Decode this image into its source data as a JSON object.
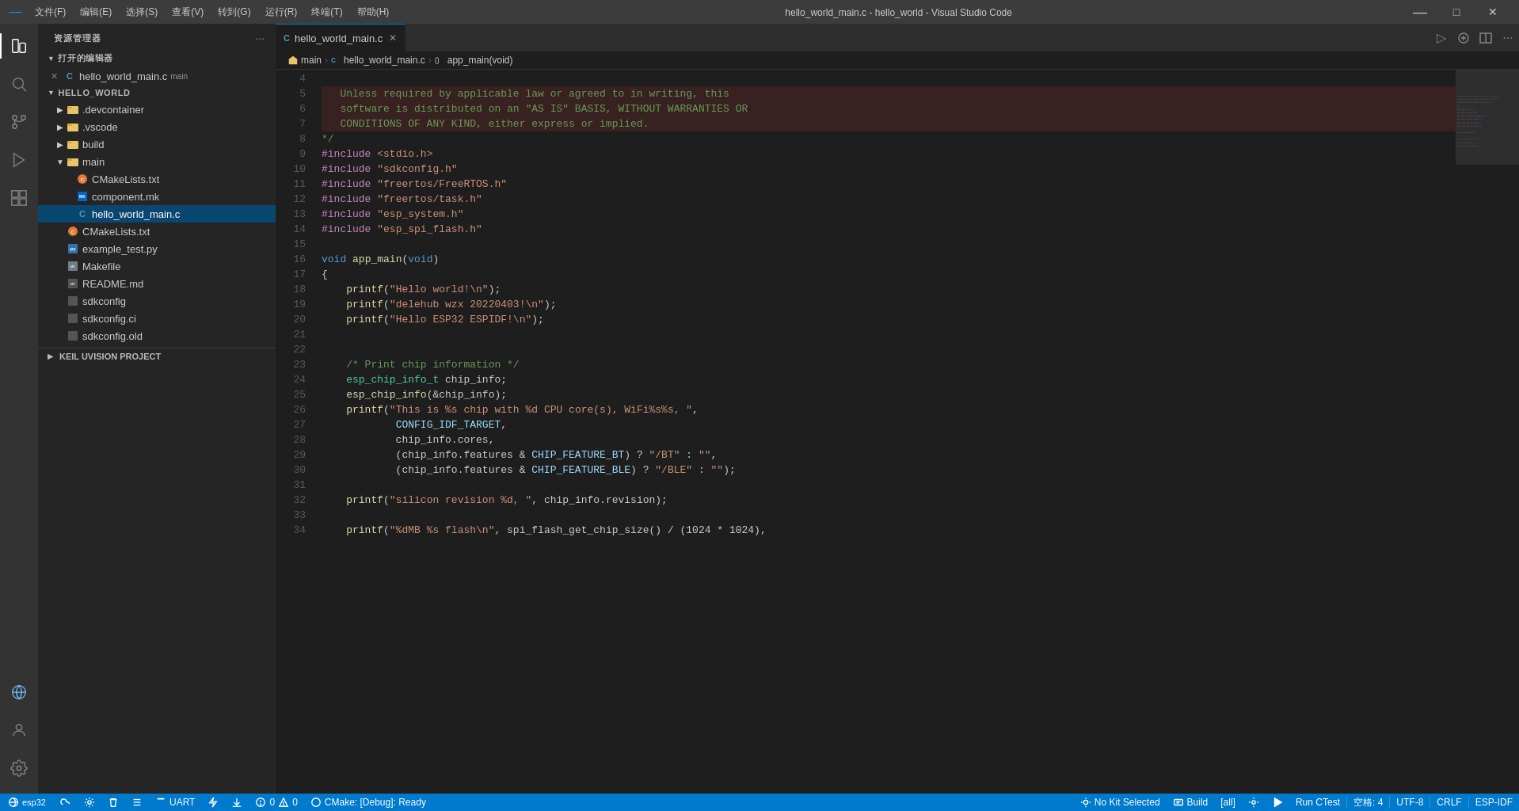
{
  "titlebar": {
    "icon": "⊘",
    "menu": [
      "文件(F)",
      "编辑(E)",
      "选择(S)",
      "查看(V)",
      "转到(G)",
      "运行(R)",
      "终端(T)",
      "帮助(H)"
    ],
    "title": "hello_world_main.c - hello_world - Visual Studio Code",
    "controls": {
      "minimize": "─",
      "maximize": "□",
      "close": "✕"
    }
  },
  "activity_bar": {
    "items": [
      {
        "name": "explorer",
        "icon": "⧉",
        "active": true
      },
      {
        "name": "search",
        "icon": "🔍"
      },
      {
        "name": "source-control",
        "icon": "⑂"
      },
      {
        "name": "run-debug",
        "icon": "▷"
      },
      {
        "name": "extensions",
        "icon": "⊞"
      }
    ],
    "bottom": [
      {
        "name": "remote",
        "icon": "⊡"
      },
      {
        "name": "account",
        "icon": "👤"
      },
      {
        "name": "settings",
        "icon": "⚙"
      }
    ]
  },
  "sidebar": {
    "title": "资源管理器",
    "actions": [
      "...",
      ""
    ],
    "open_editors": {
      "label": "打开的编辑器",
      "files": [
        {
          "name": "hello_world_main.c",
          "badge": "main",
          "modified": true
        }
      ]
    },
    "project": {
      "name": "HELLO_WORLD",
      "items": [
        {
          "type": "folder",
          "name": ".devcontainer",
          "indent": 1,
          "expanded": false
        },
        {
          "type": "folder",
          "name": ".vscode",
          "indent": 1,
          "expanded": false
        },
        {
          "type": "folder",
          "name": "build",
          "indent": 1,
          "expanded": false
        },
        {
          "type": "folder",
          "name": "main",
          "indent": 1,
          "expanded": true
        },
        {
          "type": "cmake",
          "name": "CMakeLists.txt",
          "indent": 2
        },
        {
          "type": "mk",
          "name": "component.mk",
          "indent": 2
        },
        {
          "type": "c",
          "name": "hello_world_main.c",
          "indent": 2,
          "active": true
        },
        {
          "type": "cmake",
          "name": "CMakeLists.txt",
          "indent": 1
        },
        {
          "type": "py",
          "name": "example_test.py",
          "indent": 1
        },
        {
          "type": "make",
          "name": "Makefile",
          "indent": 1
        },
        {
          "type": "md",
          "name": "README.md",
          "indent": 1
        },
        {
          "type": "file",
          "name": "sdkconfig",
          "indent": 1
        },
        {
          "type": "file",
          "name": "sdkconfig.ci",
          "indent": 1
        },
        {
          "type": "file",
          "name": "sdkconfig.old",
          "indent": 1
        }
      ]
    },
    "keil": {
      "label": "KEIL UVISION PROJECT"
    }
  },
  "tabs": [
    {
      "name": "hello_world_main.c",
      "active": true,
      "icon": "C",
      "color": "#519aba"
    }
  ],
  "breadcrumb": [
    {
      "label": "main",
      "type": "folder"
    },
    {
      "label": "hello_world_main.c",
      "type": "c-file"
    },
    {
      "label": "app_main(void)",
      "type": "function"
    }
  ],
  "code": {
    "lines": [
      {
        "num": 4,
        "content": ""
      },
      {
        "num": 5,
        "content": "   Unless required by applicable law or agreed to in writing, this",
        "highlight": true
      },
      {
        "num": 6,
        "content": "   software is distributed on an \"AS IS\" BASIS, WITHOUT WARRANTIES OR",
        "highlight": true
      },
      {
        "num": 7,
        "content": "   CONDITIONS OF ANY KIND, either express or implied.",
        "highlight": true
      },
      {
        "num": 8,
        "content": "*/"
      },
      {
        "num": 9,
        "content": "#include <stdio.h>"
      },
      {
        "num": 10,
        "content": "#include \"sdkconfig.h\""
      },
      {
        "num": 11,
        "content": "#include \"freertos/FreeRTOS.h\""
      },
      {
        "num": 12,
        "content": "#include \"freertos/task.h\""
      },
      {
        "num": 13,
        "content": "#include \"esp_system.h\""
      },
      {
        "num": 14,
        "content": "#include \"esp_spi_flash.h\""
      },
      {
        "num": 15,
        "content": ""
      },
      {
        "num": 16,
        "content": "void app_main(void)"
      },
      {
        "num": 17,
        "content": "{"
      },
      {
        "num": 18,
        "content": "    printf(\"Hello world!\\n\");"
      },
      {
        "num": 19,
        "content": "    printf(\"delehub wzx 20220403!\\n\");"
      },
      {
        "num": 20,
        "content": "    printf(\"Hello ESP32 ESPIDF!\\n\");"
      },
      {
        "num": 21,
        "content": ""
      },
      {
        "num": 22,
        "content": ""
      },
      {
        "num": 23,
        "content": "    /* Print chip information */"
      },
      {
        "num": 24,
        "content": "    esp_chip_info_t chip_info;"
      },
      {
        "num": 25,
        "content": "    esp_chip_info(&chip_info);"
      },
      {
        "num": 26,
        "content": "    printf(\"This is %s chip with %d CPU core(s), WiFi%s%s, \","
      },
      {
        "num": 27,
        "content": "            CONFIG_IDF_TARGET,"
      },
      {
        "num": 28,
        "content": "            chip_info.cores,"
      },
      {
        "num": 29,
        "content": "            (chip_info.features & CHIP_FEATURE_BT) ? \"/BT\" : \"\","
      },
      {
        "num": 30,
        "content": "            (chip_info.features & CHIP_FEATURE_BLE) ? \"/BLE\" : \"\");"
      },
      {
        "num": 31,
        "content": ""
      },
      {
        "num": 32,
        "content": "    printf(\"silicon revision %d, \", chip_info.revision);"
      },
      {
        "num": 33,
        "content": ""
      },
      {
        "num": 34,
        "content": "    printf(\"%dMB %s flash\\n\", spi_flash_get_chip_size() / (1024 * 1024),"
      }
    ]
  },
  "statusbar": {
    "left": [
      {
        "icon": "⊡",
        "text": "esp32"
      },
      {
        "icon": "☁",
        "text": ""
      },
      {
        "icon": "⚙",
        "text": ""
      },
      {
        "icon": "🗑",
        "text": ""
      },
      {
        "icon": "≡",
        "text": ""
      },
      {
        "icon": "⚡",
        "text": "UART"
      },
      {
        "icon": "🔥",
        "text": ""
      },
      {
        "icon": "⬇",
        "text": ""
      },
      {
        "icon": "⊕",
        "text": "0"
      },
      {
        "icon": "⚠",
        "text": "0"
      },
      {
        "icon": "⊙",
        "text": "CMake: [Debug]: Ready"
      }
    ],
    "right": [
      {
        "icon": "🔧",
        "text": "No Kit Selected"
      },
      {
        "text": "Build"
      },
      {
        "text": "[all]"
      },
      {
        "icon": "⚙",
        "text": ""
      },
      {
        "icon": "▷",
        "text": ""
      },
      {
        "text": "Run CTest"
      },
      {
        "text": "空格: 4"
      },
      {
        "text": "UTF-8"
      },
      {
        "text": "CRLF"
      },
      {
        "text": "ESP-IDF"
      }
    ]
  }
}
